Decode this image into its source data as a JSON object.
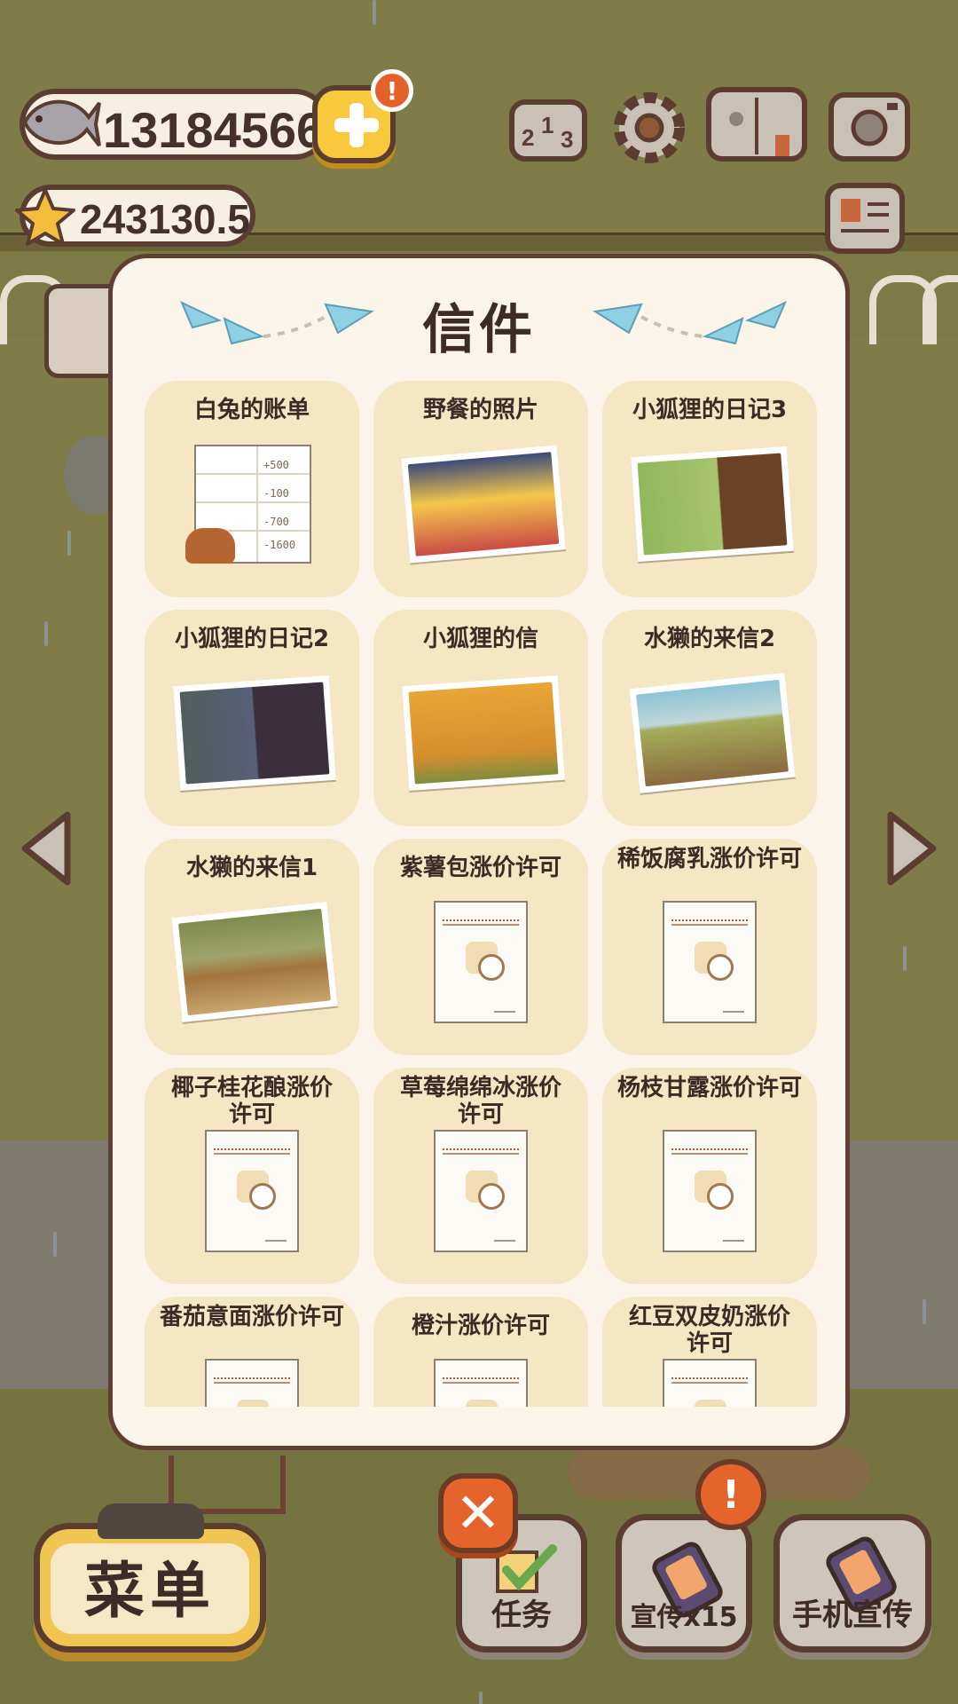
{
  "currencies": {
    "fish": "13184566",
    "stars": "243130.5",
    "alert_badge": "!"
  },
  "letters_modal": {
    "title": "信件",
    "items": [
      {
        "label": "白兔的账单",
        "kind": "ledger",
        "ledger_entries": [
          "+500",
          "-100",
          "-700",
          "-1600"
        ]
      },
      {
        "label": "野餐的照片",
        "kind": "photo",
        "colors": [
          "#f4c74b",
          "#c94c45"
        ]
      },
      {
        "label": "小狐狸的日记3",
        "kind": "photo",
        "colors": [
          "#8fb75c",
          "#6a4326"
        ]
      },
      {
        "label": "小狐狸的日记2",
        "kind": "photo",
        "colors": [
          "#4f5f5c",
          "#3c2f3c"
        ]
      },
      {
        "label": "小狐狸的信",
        "kind": "photo",
        "colors": [
          "#e9a537",
          "#c97827"
        ]
      },
      {
        "label": "水獭的来信2",
        "kind": "photo",
        "colors": [
          "#8fc3d6",
          "#a4ad5a"
        ]
      },
      {
        "label": "水獭的来信1",
        "kind": "photo",
        "colors": [
          "#7e8a4e",
          "#a2743f"
        ]
      },
      {
        "label": "紫薯包涨价许可",
        "kind": "permit"
      },
      {
        "label": "稀饭腐乳涨价许可",
        "kind": "permit"
      },
      {
        "label": "椰子桂花酿涨价许可",
        "kind": "permit"
      },
      {
        "label": "草莓绵绵冰涨价许可",
        "kind": "permit"
      },
      {
        "label": "杨枝甘露涨价许可",
        "kind": "permit"
      },
      {
        "label": "番茄意面涨价许可",
        "kind": "permit"
      },
      {
        "label": "橙汁涨价许可",
        "kind": "permit"
      },
      {
        "label": "红豆双皮奶涨价许可",
        "kind": "permit"
      }
    ]
  },
  "bottom_bar": {
    "menu_label": "菜单",
    "tasks_label": "任务",
    "promote_label": "宣传x15",
    "phone_promote_label": "手机宣传",
    "close_symbol": "✕",
    "alert_badge": "!"
  },
  "icons": [
    "fish-icon",
    "plus-icon",
    "star-icon",
    "ranking-icon",
    "gear-icon",
    "book-icon",
    "camera-icon",
    "newspaper-icon",
    "paper-plane-icon",
    "arrow-left-icon",
    "arrow-right-icon",
    "close-icon",
    "checkmark-icon",
    "phone-icon"
  ]
}
